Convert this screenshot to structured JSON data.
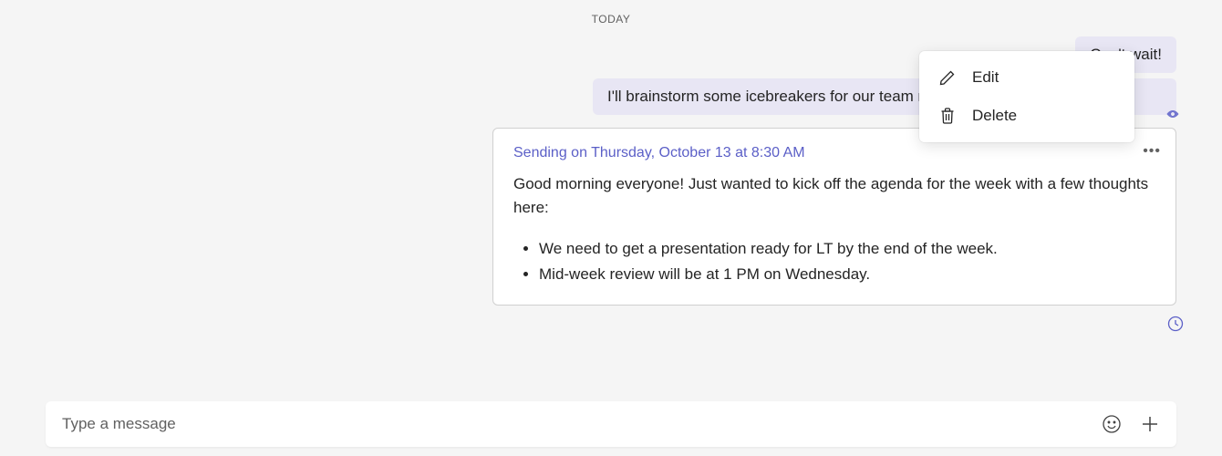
{
  "date_divider": "TODAY",
  "messages": {
    "sent1": "Can't wait!",
    "sent2": "I'll brainstorm some icebreakers for our team meeting."
  },
  "scheduled": {
    "label": "Sending on Thursday, October 13 at 8:30 AM",
    "body_intro": "Good morning everyone! Just wanted to kick off the agenda for the week with a few thoughts here:",
    "bullets": {
      "b1": "We need to get a presentation ready for LT by the end of the week.",
      "b2": "Mid-week review will be at 1 PM on Wednesday."
    }
  },
  "context_menu": {
    "edit": "Edit",
    "delete": "Delete"
  },
  "compose": {
    "placeholder": "Type a message"
  }
}
